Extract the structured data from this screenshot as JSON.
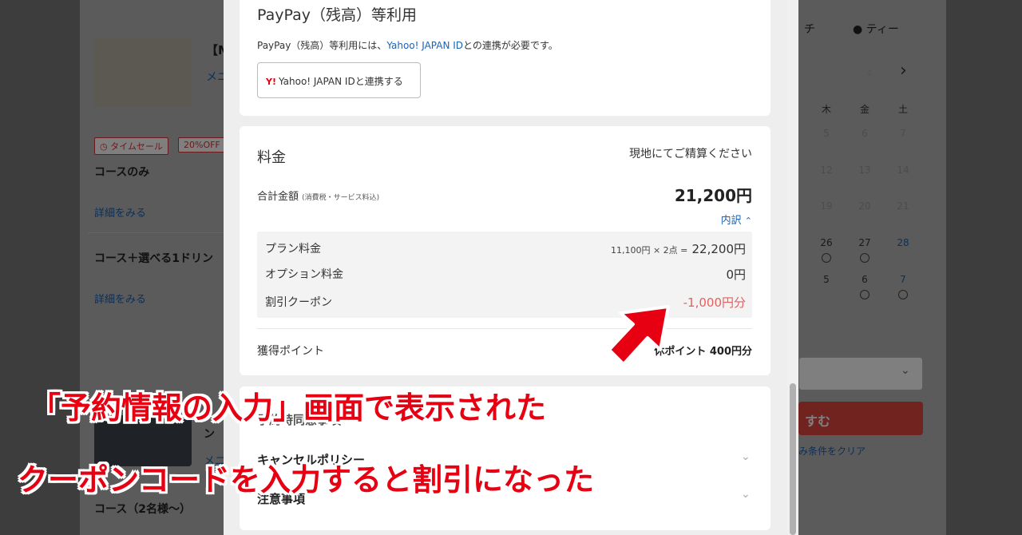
{
  "background": {
    "course_title_fragment": "【M",
    "menu_fragment": "メニ",
    "tag_timesale": "タイムセール",
    "tag_discount": "20%OFF",
    "course_only": "コースのみ",
    "detail_link": "詳細をみる",
    "course_drink": "コース＋選べる1ドリン",
    "detail_link_2": "詳細をみる",
    "course_2": "コース（2名様〜）",
    "tab_lunch_fragment": "チ",
    "tab_tea": "ティー",
    "calendar": {
      "prev_icon": "chevron-left-icon",
      "next_icon": "chevron-right-icon",
      "weekdays": [
        "木",
        "金",
        "土"
      ],
      "rows": [
        [
          "5",
          "6",
          "7"
        ],
        [
          "12",
          "13",
          "14"
        ],
        [
          "19",
          "20",
          "21"
        ],
        [
          "26",
          "27",
          "28"
        ],
        [
          "5",
          "6",
          "7"
        ]
      ]
    },
    "search_button_fragment": "すむ",
    "clear_link_fragment": "み条件をクリア",
    "menu_fragment_2": "メニ",
    "course_n": "ン"
  },
  "payment": {
    "title": "PayPay（残高）等利用",
    "note_prefix": "PayPay（残高）等利用には、",
    "note_link": "Yahoo! JAPAN ID",
    "note_suffix": "との連携が必要です。",
    "connect_logo": "Y!",
    "connect_button": "Yahoo! JAPAN IDと連携する"
  },
  "price": {
    "title": "料金",
    "pay_note": "現地にてご精算ください",
    "total_label": "合計金額",
    "total_note": "(消費税・サービス料込)",
    "total_value": "21,200円",
    "breakdown_toggle": "内訳",
    "toggle_icon": "chevron-up-icon",
    "plan_label": "プラン料金",
    "plan_calc": "11,100円 × 2点 =",
    "plan_value": "22,200円",
    "option_label": "オプション料金",
    "option_value": "0円",
    "coupon_label": "割引クーポン",
    "coupon_value": "-1,000円分",
    "points_label": "獲得ポイント",
    "points_value_fragment": "休ポイント 400円分"
  },
  "agreement": {
    "title_fragment": "予約時同意事項",
    "cancel_policy_fragment": "キャンセルポリシー",
    "notes": "注意事項"
  },
  "annotation": {
    "line1": "「予約情報の入力」画面で表示された",
    "line2": "クーポンコードを入力すると割引になった",
    "arrow_icon": "red-arrow-icon",
    "color": "#e60012"
  }
}
